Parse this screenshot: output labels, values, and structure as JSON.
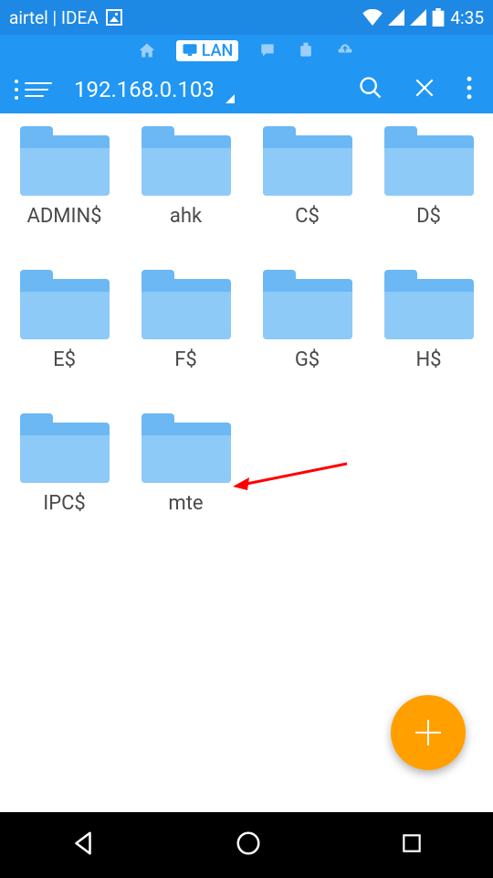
{
  "status_bar": {
    "carrier": "airtel | IDEA",
    "time": "4:35"
  },
  "tabs": {
    "active_label": "LAN"
  },
  "toolbar": {
    "address": "192.168.0.103"
  },
  "folders": [
    {
      "name": "ADMIN$"
    },
    {
      "name": "ahk"
    },
    {
      "name": "C$"
    },
    {
      "name": "D$"
    },
    {
      "name": "E$"
    },
    {
      "name": "F$"
    },
    {
      "name": "G$"
    },
    {
      "name": "H$"
    },
    {
      "name": "IPC$"
    },
    {
      "name": "mte"
    }
  ],
  "annotation": {
    "target_folder": "mte"
  }
}
